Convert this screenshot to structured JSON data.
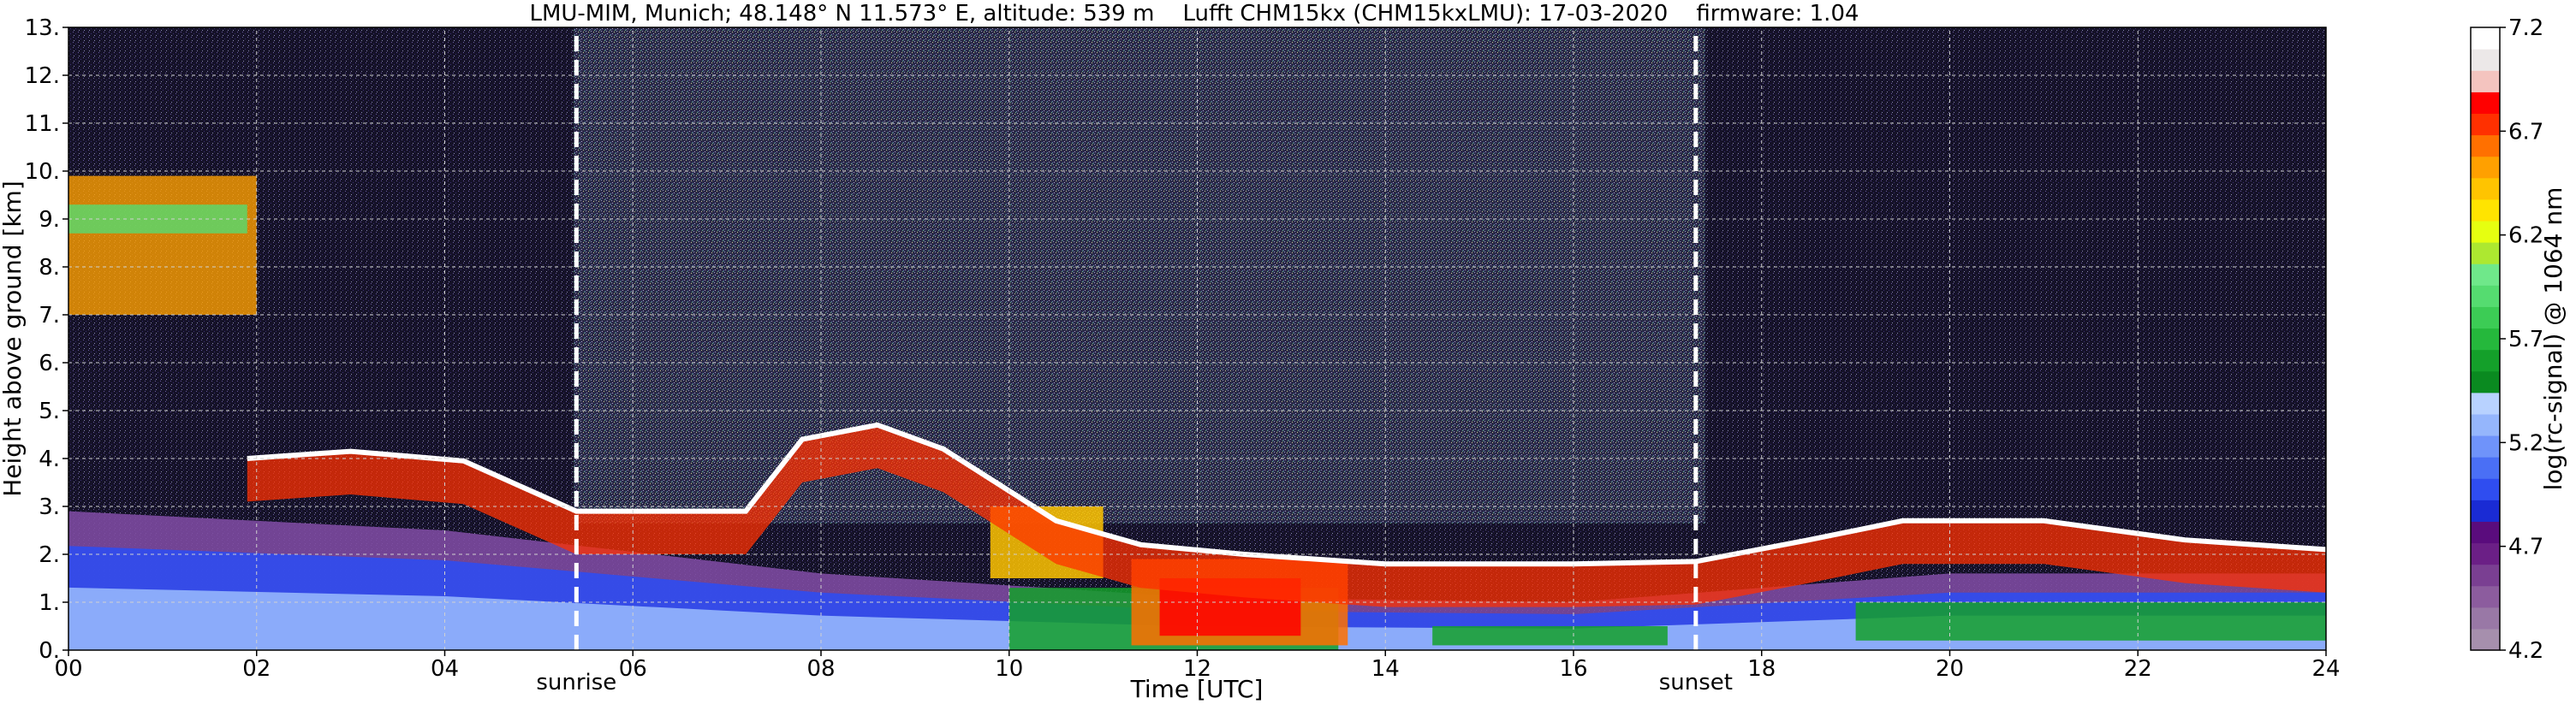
{
  "chart_data": [
    {
      "type": "heatmap",
      "title": "LMU-MIM, Munich; 48.148° N 11.573° E, altitude: 539 m    Lufft CHM15kx (CHM15kxLMU): 17-03-2020    firmware: 1.04",
      "xlabel": "Time [UTC]",
      "ylabel": "Height above ground [km]",
      "xlim": [
        0,
        24
      ],
      "ylim": [
        0,
        13
      ],
      "xticks": [
        "00",
        "02",
        "04",
        "06",
        "08",
        "10",
        "12",
        "14",
        "16",
        "18",
        "20",
        "22",
        "24"
      ],
      "yticks": [
        "0.",
        "1.",
        "2.",
        "3.",
        "4.",
        "5.",
        "6.",
        "7.",
        "8.",
        "9.",
        "10.",
        "11.",
        "12.",
        "13."
      ],
      "grid": true,
      "annotations": [
        {
          "text": "sunrise",
          "x": 5.4
        },
        {
          "text": "sunset",
          "x": 17.3
        }
      ],
      "cloud_base_layer": [
        {
          "x": 1.9,
          "y": 4.0
        },
        {
          "x": 3.0,
          "y": 4.15
        },
        {
          "x": 4.2,
          "y": 3.95
        },
        {
          "x": 5.4,
          "y": 2.9
        },
        {
          "x": 7.2,
          "y": 2.9
        },
        {
          "x": 7.8,
          "y": 4.4
        },
        {
          "x": 8.6,
          "y": 4.7
        },
        {
          "x": 9.3,
          "y": 4.2
        },
        {
          "x": 10.5,
          "y": 2.7
        },
        {
          "x": 11.4,
          "y": 2.2
        },
        {
          "x": 12.5,
          "y": 2.0
        },
        {
          "x": 14.0,
          "y": 1.8
        },
        {
          "x": 16.0,
          "y": 1.8
        },
        {
          "x": 17.3,
          "y": 1.85
        },
        {
          "x": 18.5,
          "y": 2.3
        },
        {
          "x": 19.5,
          "y": 2.7
        },
        {
          "x": 21.0,
          "y": 2.7
        },
        {
          "x": 22.5,
          "y": 2.3
        },
        {
          "x": 24.0,
          "y": 2.1
        }
      ],
      "cirrus_layer": {
        "x_range": [
          0,
          2.0
        ],
        "y_range": [
          7.0,
          9.9
        ]
      },
      "boundary_layer_top": [
        {
          "x": 0,
          "y": 2.9
        },
        {
          "x": 4,
          "y": 2.5
        },
        {
          "x": 8,
          "y": 1.6
        },
        {
          "x": 12,
          "y": 1.1
        },
        {
          "x": 16,
          "y": 1.0
        },
        {
          "x": 20,
          "y": 1.6
        },
        {
          "x": 24,
          "y": 1.6
        }
      ]
    },
    {
      "type": "colorbar",
      "label": "log(rc-signal) @ 1064 nm",
      "range": [
        4.2,
        7.2
      ],
      "ticks": [
        "4.2",
        "4.7",
        "5.2",
        "5.7",
        "6.2",
        "6.7",
        "7.2"
      ],
      "colors": [
        "#a68fad",
        "#9978a6",
        "#8c5c9e",
        "#7a3f92",
        "#6b1f86",
        "#5a0c7d",
        "#1a2bd4",
        "#2f4df0",
        "#4a6ff5",
        "#6f93fa",
        "#95b6fc",
        "#b8d2ff",
        "#0a8a20",
        "#14a02a",
        "#25b83c",
        "#3ccc55",
        "#55dc70",
        "#6fe88a",
        "#ade830",
        "#e6ff10",
        "#ffe400",
        "#ffc400",
        "#ffa000",
        "#ff7000",
        "#ff3000",
        "#ff0000",
        "#f4c4bf",
        "#ece8e8",
        "#ffffff"
      ]
    }
  ]
}
